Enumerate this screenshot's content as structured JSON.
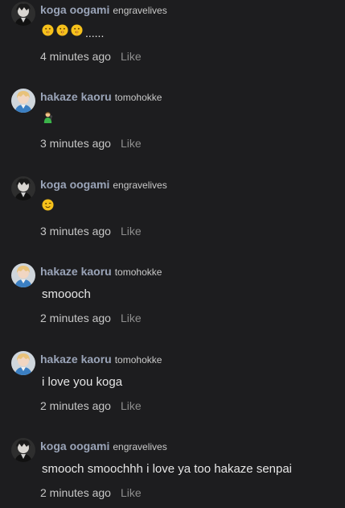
{
  "comments": [
    {
      "name": "koga oogami",
      "handle": "engravelives",
      "text": "",
      "emojis": [
        "shushing-face-emoji",
        "shushing-face-emoji",
        "shushing-face-emoji"
      ],
      "trailing": "......",
      "time": "4 minutes ago",
      "like": "Like"
    },
    {
      "name": "hakaze kaoru",
      "handle": "tomohokke",
      "text": "",
      "emojis": [
        "man-singer-emoji"
      ],
      "trailing": "",
      "time": "3 minutes ago",
      "like": "Like"
    },
    {
      "name": "koga oogami",
      "handle": "engravelives",
      "text": "",
      "emojis": [
        "winking-face-emoji"
      ],
      "trailing": "",
      "time": "3 minutes ago",
      "like": "Like"
    },
    {
      "name": "hakaze kaoru",
      "handle": "tomohokke",
      "text": "smoooch",
      "emojis": [],
      "trailing": "",
      "time": "2 minutes ago",
      "like": "Like"
    },
    {
      "name": "hakaze kaoru",
      "handle": "tomohokke",
      "text": "i love you koga",
      "emojis": [],
      "trailing": "",
      "time": "2 minutes ago",
      "like": "Like"
    },
    {
      "name": "koga oogami",
      "handle": "engravelives",
      "text": "smooch smoochhh i love ya too hakaze senpai",
      "emojis": [],
      "trailing": "",
      "time": "2 minutes ago",
      "like": "Like"
    }
  ]
}
